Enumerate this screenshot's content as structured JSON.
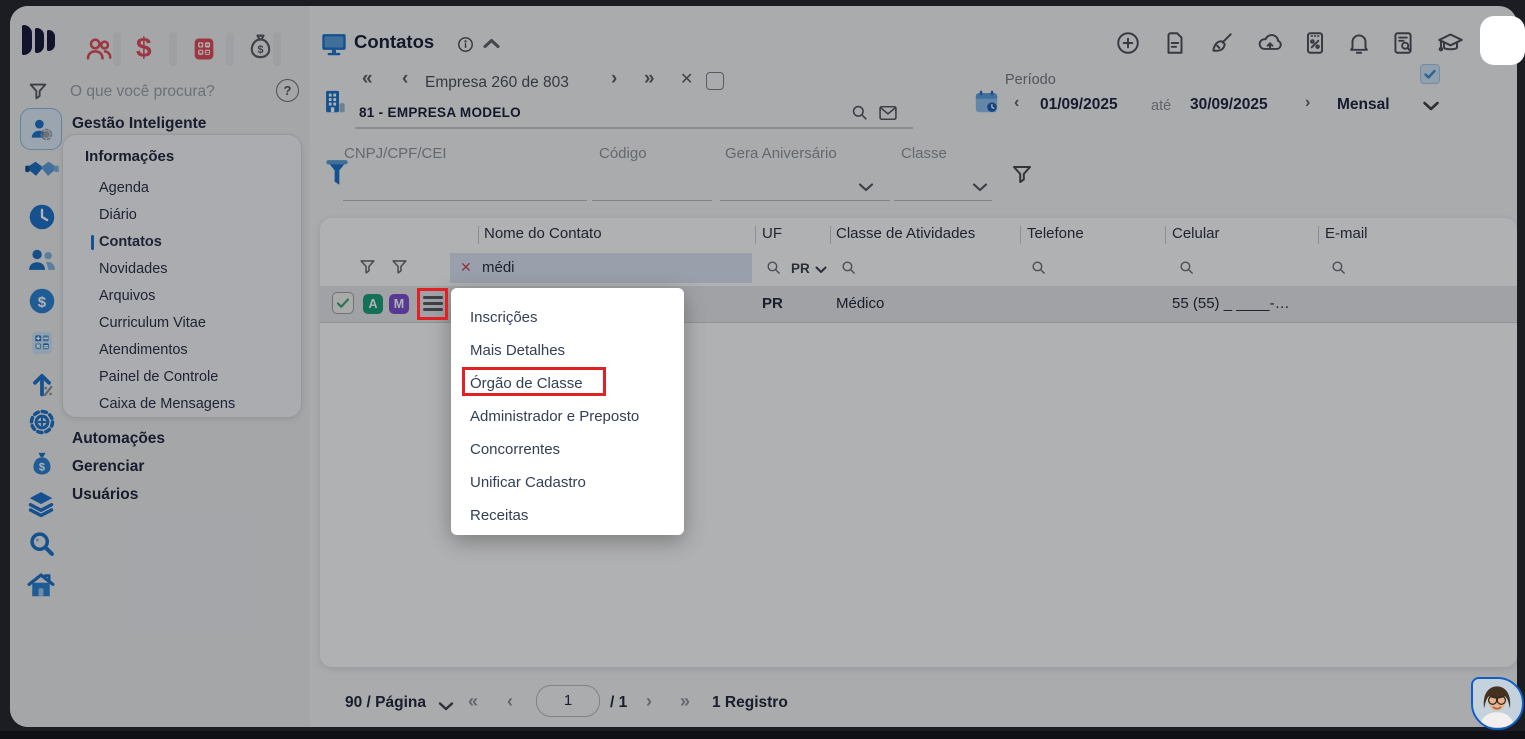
{
  "topbar": {
    "search_placeholder": "O que você procura?",
    "help": "?"
  },
  "sidebar": {
    "section_title": "Gestão Inteligente",
    "submenu_title": "Informações",
    "items": [
      "Agenda",
      "Diário",
      "Contatos",
      "Novidades",
      "Arquivos",
      "Curriculum Vitae",
      "Atendimentos",
      "Painel de Controle",
      "Caixa de Mensagens"
    ],
    "active_item": "Contatos",
    "bottom_items": [
      "Automações",
      "Gerenciar",
      "Usuários"
    ]
  },
  "header": {
    "title": "Contatos",
    "company_nav_label": "Empresa 260 de 803",
    "company_name": "81 - EMPRESA MODELO",
    "period": {
      "label": "Período",
      "from": "01/09/2025",
      "until": "até",
      "to": "30/09/2025",
      "mode": "Mensal"
    }
  },
  "filters": {
    "cnpj_label": "CNPJ/CPF/CEI",
    "codigo_label": "Código",
    "aniversario_label": "Gera Aniversário",
    "classe_label": "Classe"
  },
  "table": {
    "columns": [
      "Nome do Contato",
      "UF",
      "Classe de Atividades",
      "Telefone",
      "Celular",
      "E-mail"
    ],
    "name_filter": "médi",
    "uf_filter": "PR",
    "row": {
      "badge_a": "A",
      "badge_m": "M",
      "uf": "PR",
      "classe": "Médico",
      "celular": "55 (55) _ ____-…"
    }
  },
  "context_menu": {
    "items": [
      "Inscrições",
      "Mais Detalhes",
      "Órgão de Classe",
      "Administrador e Preposto",
      "Concorrentes",
      "Unificar Cadastro",
      "Receitas"
    ],
    "highlighted": "Órgão de Classe"
  },
  "pagination": {
    "per_page": "90 / Página",
    "page": "1",
    "total": "/ 1",
    "records": "1 Registro"
  },
  "icons": {
    "dollar": "$",
    "clear": "✕",
    "close": "✕",
    "first": "«",
    "prev": "‹",
    "next": "›",
    "last": "»",
    "toolbar_right": [
      "add",
      "document",
      "broom",
      "cloud-upload",
      "discount",
      "bell",
      "document-search",
      "graduation-cap"
    ],
    "rail": [
      "management",
      "handshake",
      "clock",
      "people",
      "finance",
      "calculator",
      "growth",
      "settings",
      "payroll",
      "layers",
      "search",
      "home"
    ]
  },
  "colors": {
    "accent_blue": "#1b72c8",
    "highlight_red": "#e02226",
    "badge_green": "#18a078",
    "badge_purple": "#7c4fd0",
    "check_green": "#3aa57c",
    "icon_red": "#e04a57"
  }
}
